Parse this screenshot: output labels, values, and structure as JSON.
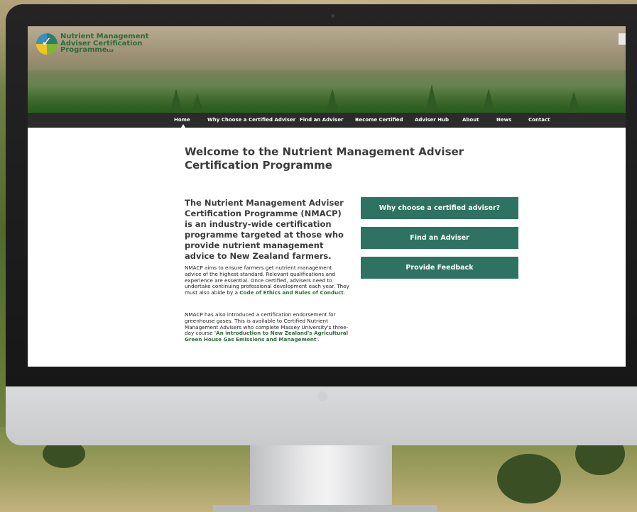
{
  "logo": {
    "line1": "Nutrient Management",
    "line2": "Adviser Certification",
    "line3": "Programme",
    "line3_suffix": "Ltd"
  },
  "nav": {
    "items": [
      {
        "label": "Home"
      },
      {
        "label": "Why Choose a Certified Adviser"
      },
      {
        "label": "Find an Adviser"
      },
      {
        "label": "Become Certified"
      },
      {
        "label": "Adviser Hub"
      },
      {
        "label": "About"
      },
      {
        "label": "News"
      },
      {
        "label": "Contact"
      }
    ],
    "active": "Home"
  },
  "main": {
    "title": "Welcome to the Nutrient Management Adviser Certification Programme",
    "lead": "The Nutrient Management Adviser Certification Programme (NMACP) is an industry-wide certification programme targeted at those who provide nutrient management advice to New Zealand farmers.",
    "para1_text": "NMACP aims to ensure farmers get nutrient management advice of the highest standard. Relevant qualifications and experience are essential. Once certified, advisers need to undertake continuing professional development each year. They must also abide by a ",
    "para1_link": "Code of Ethics and Rules of Conduct",
    "para1_end": ".",
    "para2_text": "NMACP has also introduced a certification endorsement for greenhouse gases. This is available to Certified Nutrient Management Advisers who complete Massey University's three-day course ",
    "para2_link": "'An introduction to New Zealand's Agricultural Green House Gas Emissions and Management'",
    "para2_end": "."
  },
  "buttons": {
    "why": "Why choose a certified adviser?",
    "find": "Find an Adviser",
    "feedback": "Provide Feedback"
  },
  "colors": {
    "accent": "#2e7361",
    "nav_bg": "#2b2b2b",
    "link": "#2e6b38"
  }
}
